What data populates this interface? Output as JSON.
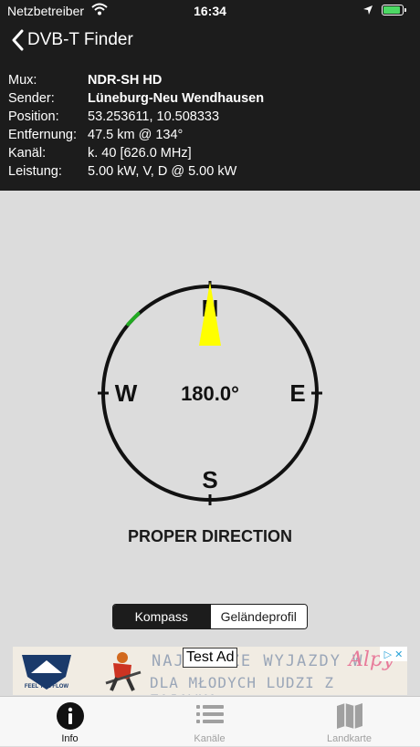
{
  "statusbar": {
    "carrier": "Netzbetreiber",
    "time": "16:34",
    "battery_fraction": 0.9,
    "battery_color": "#4cd964"
  },
  "navbar": {
    "back_icon": "chevron-left-icon",
    "title": "DVB-T Finder"
  },
  "info": {
    "rows": [
      {
        "label": "Mux:",
        "value": "NDR-SH HD",
        "bold": true
      },
      {
        "label": "Sender:",
        "value": "Lüneburg-Neu Wendhausen",
        "bold": true
      },
      {
        "label": "Position:",
        "value": "53.253611, 10.508333",
        "bold": false
      },
      {
        "label": "Entfernung:",
        "value": "47.5 km @ 134°",
        "bold": false
      },
      {
        "label": "Kanäl:",
        "value": "k. 40 [626.0 MHz]",
        "bold": false
      },
      {
        "label": "Leistung:",
        "value": "5.00 kW, V, D @ 5.00 kW",
        "bold": false
      }
    ]
  },
  "compass": {
    "north": "N",
    "west": "W",
    "east": "E",
    "south": "S",
    "heading_text": "180.0°",
    "heading_deg": 180.0,
    "target_deg": 134,
    "needle_color": "#ffff00",
    "target_color": "#22aa22"
  },
  "status_text": "PROPER DIRECTION",
  "segmented": {
    "options": [
      "Kompass",
      "Geländeprofil"
    ],
    "selected": "Kompass"
  },
  "ad": {
    "badge": "Test Ad",
    "line1": "NAJLEPSZE WYJAZDY W",
    "line2": "DLA MŁODYCH LUDZI Z ZAJAWKĄ",
    "brand": "Alpy",
    "logo_text": "FEEL THE FLOW"
  },
  "tabs": [
    {
      "label": "Info",
      "icon": "info-icon",
      "active": true
    },
    {
      "label": "Kanäle",
      "icon": "list-icon",
      "active": false
    },
    {
      "label": "Landkarte",
      "icon": "map-icon",
      "active": false
    }
  ]
}
